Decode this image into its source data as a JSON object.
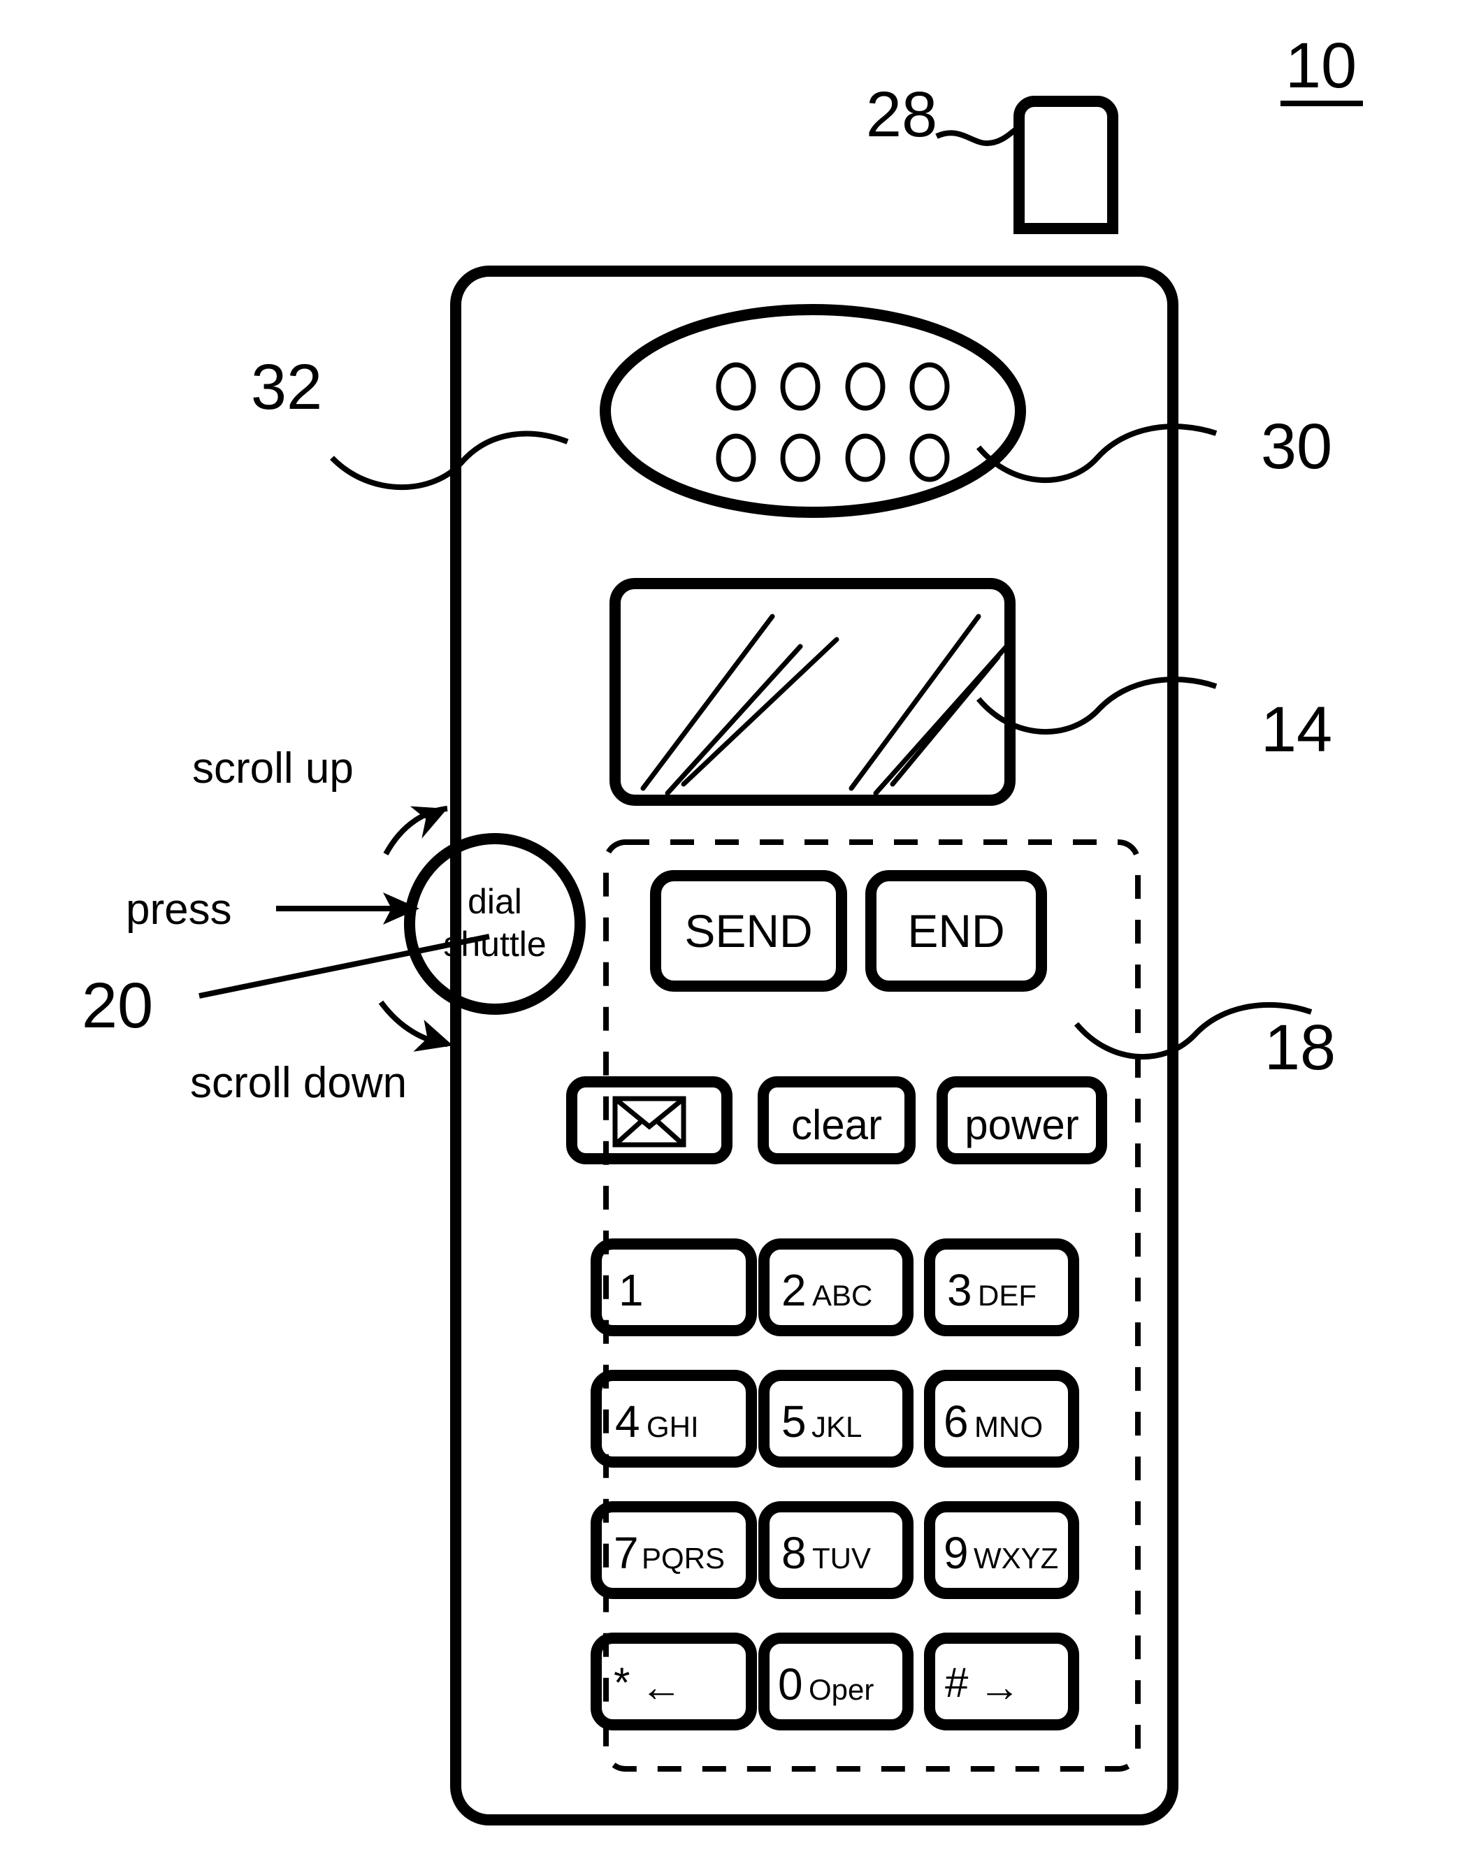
{
  "figure": {
    "title_ref": "10",
    "type": "patent-line-drawing",
    "description": "Cellular telephone handset with dial shuttle control"
  },
  "reference_numerals": {
    "handset": "10",
    "antenna": "28",
    "speaker_grille": "30",
    "earpiece_housing": "32",
    "display": "14",
    "keypad": "18",
    "dial_shuttle": "20"
  },
  "callouts": {
    "scroll_up": "scroll up",
    "press": "press",
    "scroll_down": "scroll down"
  },
  "dial_shuttle": {
    "line1": "dial",
    "line2": "shuttle"
  },
  "function_keys": [
    {
      "name": "send-key",
      "label": "SEND"
    },
    {
      "name": "end-key",
      "label": "END"
    }
  ],
  "utility_keys": [
    {
      "name": "message-key",
      "label": "",
      "icon": "envelope-icon"
    },
    {
      "name": "clear-key",
      "label": "clear",
      "icon": ""
    },
    {
      "name": "power-key",
      "label": "power",
      "icon": ""
    }
  ],
  "keypad": {
    "rows": [
      [
        {
          "name": "key-1",
          "digit": "1",
          "letters": ""
        },
        {
          "name": "key-2",
          "digit": "2",
          "letters": "ABC"
        },
        {
          "name": "key-3",
          "digit": "3",
          "letters": "DEF"
        }
      ],
      [
        {
          "name": "key-4",
          "digit": "4",
          "letters": "GHI"
        },
        {
          "name": "key-5",
          "digit": "5",
          "letters": "JKL"
        },
        {
          "name": "key-6",
          "digit": "6",
          "letters": "MNO"
        }
      ],
      [
        {
          "name": "key-7",
          "digit": "7",
          "letters": "PQRS"
        },
        {
          "name": "key-8",
          "digit": "8",
          "letters": "TUV"
        },
        {
          "name": "key-9",
          "digit": "9",
          "letters": "WXYZ"
        }
      ],
      [
        {
          "name": "key-star",
          "digit": "*",
          "letters": "←"
        },
        {
          "name": "key-0",
          "digit": "0",
          "letters": "Oper"
        },
        {
          "name": "key-pound",
          "digit": "#",
          "letters": "→"
        }
      ]
    ]
  },
  "speaker": {
    "hole_rows": 2,
    "hole_cols": 4
  },
  "colors": {
    "ink": "#000000",
    "paper": "#ffffff"
  }
}
